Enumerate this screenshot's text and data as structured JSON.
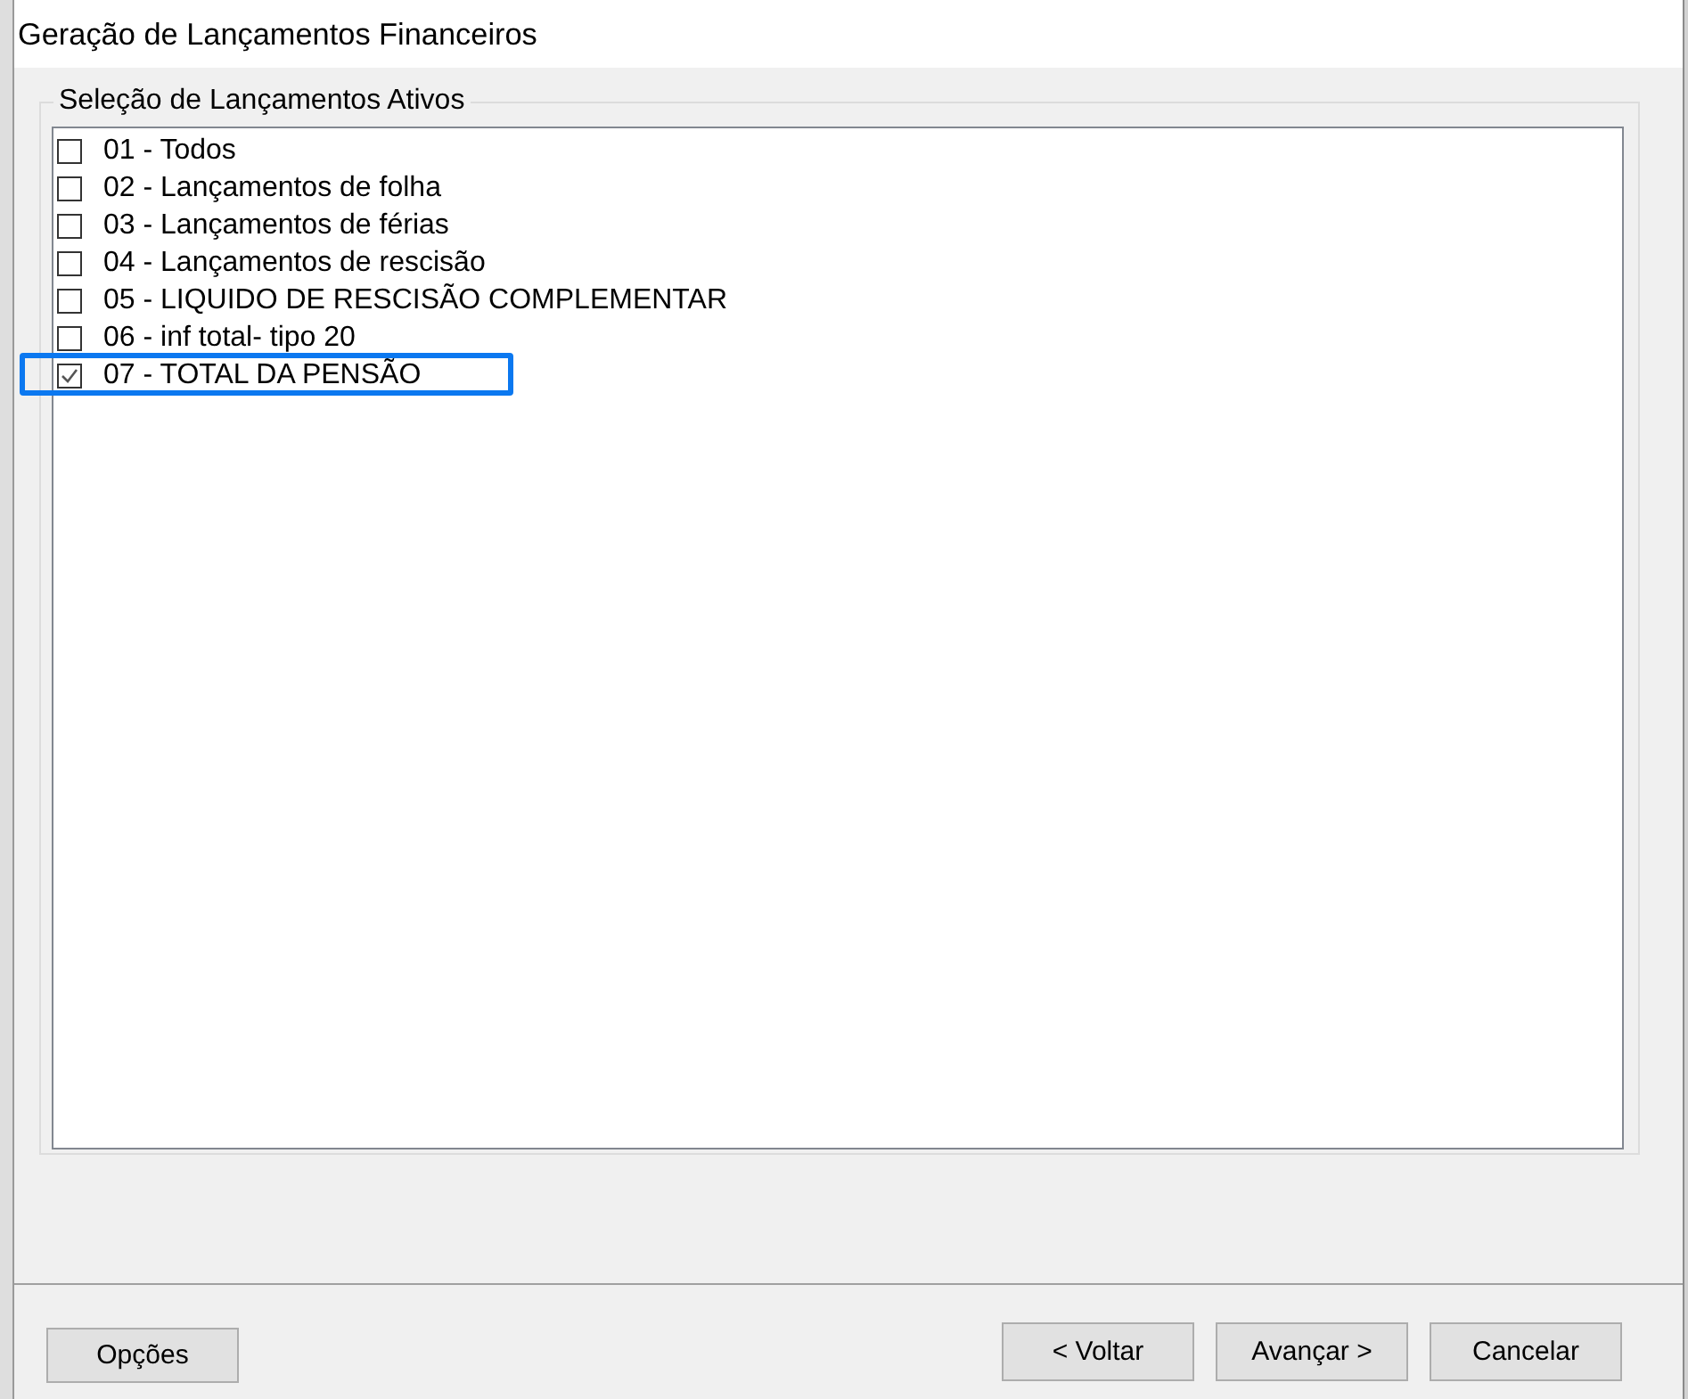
{
  "window": {
    "title": "Geração de Lançamentos Financeiros"
  },
  "group": {
    "title": "Seleção de Lançamentos Ativos",
    "items": [
      {
        "label": "01 - Todos",
        "checked": false,
        "highlighted": false
      },
      {
        "label": "02 - Lançamentos de folha",
        "checked": false,
        "highlighted": false
      },
      {
        "label": "03 - Lançamentos de férias",
        "checked": false,
        "highlighted": false
      },
      {
        "label": "04 - Lançamentos de rescisão",
        "checked": false,
        "highlighted": false
      },
      {
        "label": "05 - LIQUIDO DE RESCISÃO COMPLEMENTAR",
        "checked": false,
        "highlighted": false
      },
      {
        "label": "06 - inf total- tipo 20",
        "checked": false,
        "highlighted": false
      },
      {
        "label": "07 - TOTAL DA PENSÃO",
        "checked": true,
        "highlighted": true
      }
    ]
  },
  "buttons": [
    {
      "label": "Opções",
      "kind": "options"
    },
    {
      "label": "< Voltar",
      "kind": "nav"
    },
    {
      "label": "Avançar >",
      "kind": "nav"
    },
    {
      "label": "Cancelar",
      "kind": "nav"
    }
  ]
}
